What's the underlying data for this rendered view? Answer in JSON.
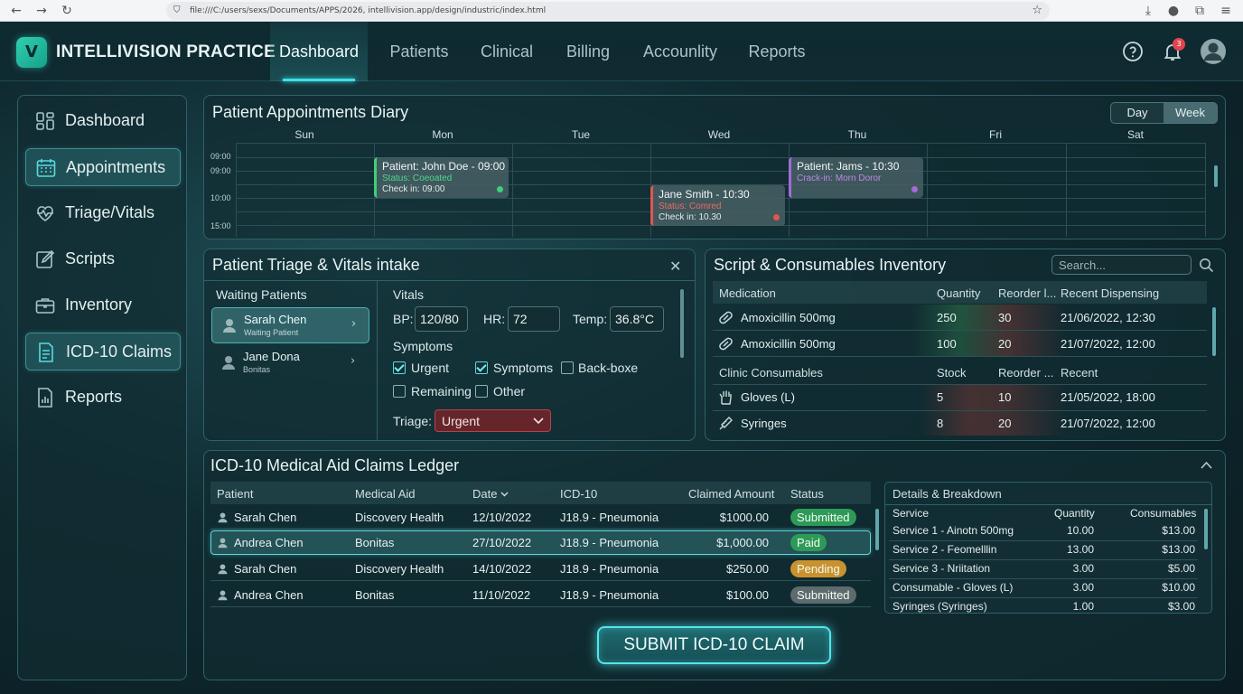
{
  "browser": {
    "url": "file:///C:/users/sexs/Documents/APPS/2026, intellivision.app/design/industric/index.html"
  },
  "app": {
    "brand": "INTELLIVISION PRACTICE",
    "logo_letter": "V",
    "notification_count": "3"
  },
  "nav": {
    "tabs": [
      "Dashboard",
      "Patients",
      "Clinical",
      "Billing",
      "Accounlity",
      "Reports"
    ],
    "active": "Dashboard"
  },
  "sidebar": {
    "items": [
      {
        "label": "Dashboard",
        "icon": "grid-icon"
      },
      {
        "label": "Appointments",
        "icon": "calendar-icon",
        "active": true
      },
      {
        "label": "Triage/Vitals",
        "icon": "heartbeat-icon"
      },
      {
        "label": "Scripts",
        "icon": "edit-icon"
      },
      {
        "label": "Inventory",
        "icon": "briefcase-icon"
      },
      {
        "label": "ICD-10 Claims",
        "icon": "document-icon",
        "active": true
      },
      {
        "label": "Reports",
        "icon": "report-icon"
      }
    ]
  },
  "diary": {
    "title": "Patient Appointments Diary",
    "view_day": "Day",
    "view_week": "Week",
    "active_view": "Week",
    "days": [
      "Sun",
      "Mon",
      "Tue",
      "Wed",
      "Thu",
      "Fri",
      "Sat"
    ],
    "times": [
      "09:00",
      "09:00",
      "10:00",
      "15:00"
    ],
    "appointments": [
      {
        "title": "Patient: John Doe - 09:00",
        "status": "Status: Coeoated",
        "checkin": "Check in: 09:00",
        "color": "#3ecf7a"
      },
      {
        "title": "Jane Smith - 10:30",
        "status": "Status: Comred",
        "checkin": "Check in: 10.30",
        "color": "#e3554f"
      },
      {
        "title": "Patient: Jams - 10:30",
        "status": "Crack-in: Morn Doror",
        "color": "#a56ad8"
      }
    ]
  },
  "triage": {
    "title": "Patient Triage & Vitals intake",
    "waiting_title": "Waiting Patients",
    "patients": [
      {
        "name": "Sarah Chen",
        "sub": "Waiting Patient"
      },
      {
        "name": "Jane Dona",
        "sub": "Bonitas"
      }
    ],
    "vitals_title": "Vitals",
    "bp_label": "BP:",
    "bp_value": "120/80",
    "hr_label": "HR:",
    "hr_value": "72",
    "temp_label": "Temp:",
    "temp_value": "36.8°C",
    "symptoms_title": "Symptoms",
    "symptoms": [
      {
        "label": "Urgent",
        "checked": true
      },
      {
        "label": "Symptoms",
        "checked": true
      },
      {
        "label": "Back-boxe",
        "checked": false
      },
      {
        "label": "Remaining",
        "checked": false
      },
      {
        "label": "Other",
        "checked": false
      }
    ],
    "triage_label": "Triage:",
    "triage_value": "Urgent"
  },
  "inventory": {
    "title": "Script & Consumables Inventory",
    "search_placeholder": "Search...",
    "med_headers": [
      "Medication",
      "Quantity",
      "Reorder l...",
      "Recent Dispensing"
    ],
    "meds": [
      {
        "name": "Amoxicillin 500mg",
        "qty": "250",
        "reorder": "30",
        "recent": "21/06/2022, 12:30"
      },
      {
        "name": "Amoxicillin 500mg",
        "qty": "100",
        "reorder": "20",
        "recent": "21/07/2022, 12:00"
      }
    ],
    "cons_headers": [
      "Clinic Consumables",
      "Stock",
      "Reorder ...",
      "Recent"
    ],
    "consumables": [
      {
        "name": "Gloves (L)",
        "qty": "5",
        "reorder": "10",
        "recent": "21/05/2022, 18:00"
      },
      {
        "name": "Syringes",
        "qty": "8",
        "reorder": "20",
        "recent": "21/07/2022, 12:00"
      }
    ]
  },
  "claims": {
    "title": "ICD-10 Medical Aid Claims Ledger",
    "headers": [
      "Patient",
      "Medical Aid",
      "Date",
      "ICD-10",
      "Claimed Amount",
      "Status"
    ],
    "rows": [
      {
        "patient": "Sarah Chen",
        "aid": "Discovery Health",
        "date": "12/10/2022",
        "icd": "J18.9 - Pneumonia",
        "amount": "$1000.00",
        "status": "Submitted",
        "status_color": "#2e9a57"
      },
      {
        "patient": "Andrea Chen",
        "aid": "Bonitas",
        "date": "27/10/2022",
        "icd": "J18.9 - Pneumonia",
        "amount": "$1,000.00",
        "status": "Paid",
        "status_color": "#2e9a57"
      },
      {
        "patient": "Sarah Chen",
        "aid": "Discovery Health",
        "date": "14/10/2022",
        "icd": "J18.9 - Pneumonia",
        "amount": "$250.00",
        "status": "Pending",
        "status_color": "#c9922e"
      },
      {
        "patient": "Andrea Chen",
        "aid": "Bonitas",
        "date": "11/10/2022",
        "icd": "J18.9 - Pneumonia",
        "amount": "$100.00",
        "status": "Submitted",
        "status_color": "#5d6b6e"
      }
    ],
    "details": {
      "title": "Details & Breakdown",
      "headers": [
        "Service",
        "Quantity",
        "Consumables"
      ],
      "rows": [
        {
          "service": "Service 1 - Ainotn 500mg",
          "qty": "10.00",
          "cons": "$13.00"
        },
        {
          "service": "Service 2 - Feomelllin",
          "qty": "13.00",
          "cons": "$13.00"
        },
        {
          "service": "Service 3 - Nriitation",
          "qty": "3.00",
          "cons": "$5.00"
        },
        {
          "service": "Consumable - Gloves (L)",
          "qty": "3.00",
          "cons": "$10.00"
        },
        {
          "service": "Syringes (Syringes)",
          "qty": "1.00",
          "cons": "$3.00"
        }
      ]
    },
    "submit_label": "SUBMIT ICD-10 CLAIM"
  }
}
